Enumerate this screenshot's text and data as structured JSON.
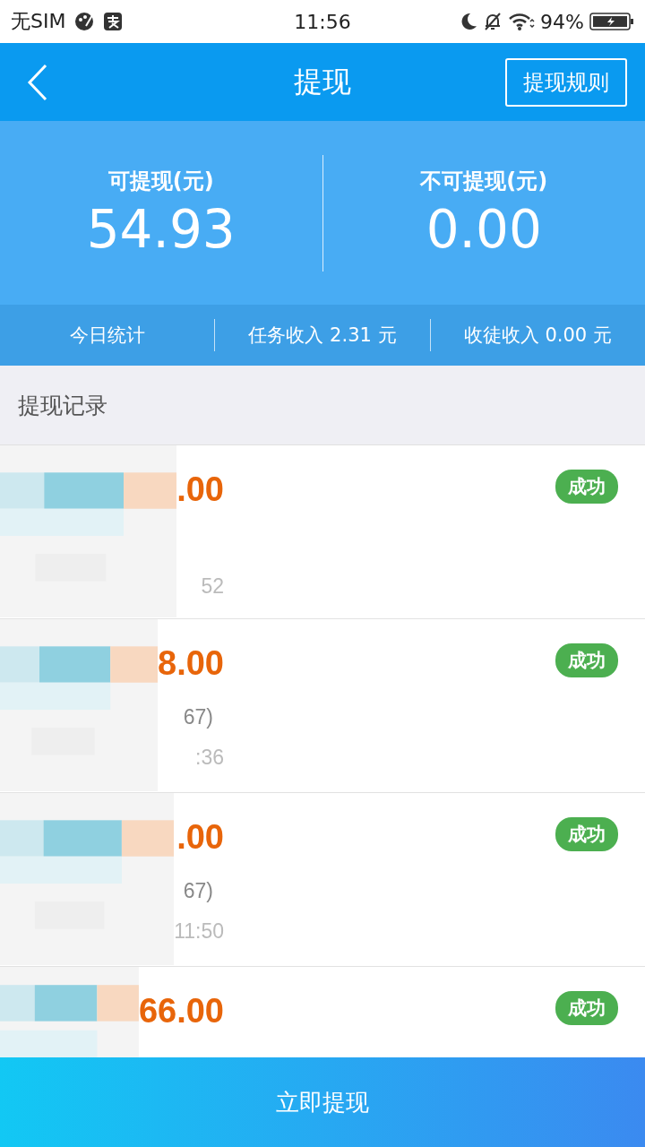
{
  "status_bar": {
    "carrier": "无SIM",
    "time": "11:56",
    "battery": "94%"
  },
  "nav": {
    "title": "提现",
    "rules_button": "提现规则"
  },
  "balances": [
    {
      "label": "可提现(元)",
      "amount": "54.93"
    },
    {
      "label": "不可提现(元)",
      "amount": "0.00"
    }
  ],
  "stats": [
    "今日统计",
    "任务收入 2.31 元",
    "收徒收入 0.00 元"
  ],
  "records_title": "提现记录",
  "records": [
    {
      "amount": ".00",
      "time": "52",
      "status": "成功"
    },
    {
      "amount": "8.00",
      "account": "67)",
      "time": ":36",
      "status": "成功"
    },
    {
      "amount": ".00",
      "account": "67)",
      "time": "11:50",
      "status": "成功"
    },
    {
      "amount": "66.00",
      "status": "成功"
    }
  ],
  "withdraw_button": "立即提现"
}
